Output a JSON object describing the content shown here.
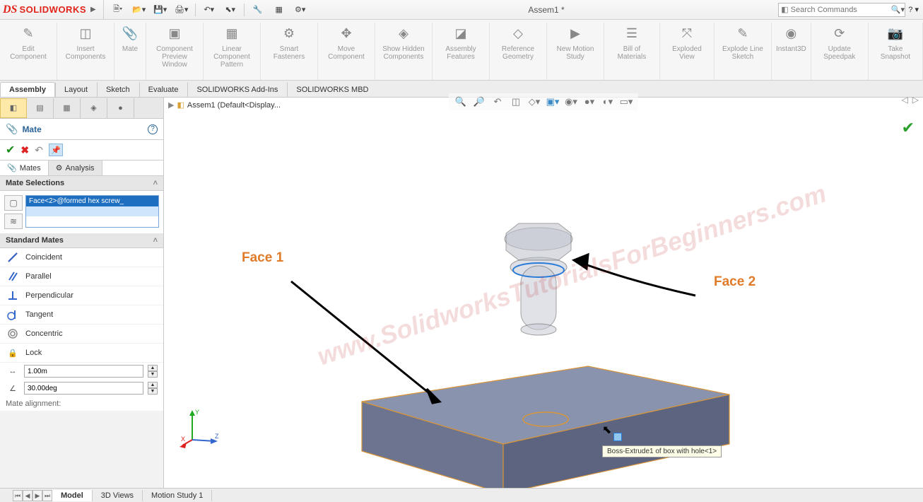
{
  "app": {
    "name": "SOLIDWORKS",
    "doc_title": "Assem1 *"
  },
  "search": {
    "placeholder": "Search Commands"
  },
  "ribbon": [
    {
      "label": "Edit Component"
    },
    {
      "label": "Insert Components"
    },
    {
      "label": "Mate"
    },
    {
      "label": "Component Preview Window"
    },
    {
      "label": "Linear Component Pattern"
    },
    {
      "label": "Smart Fasteners"
    },
    {
      "label": "Move Component"
    },
    {
      "label": "Show Hidden Components"
    },
    {
      "label": "Assembly Features"
    },
    {
      "label": "Reference Geometry"
    },
    {
      "label": "New Motion Study"
    },
    {
      "label": "Bill of Materials"
    },
    {
      "label": "Exploded View"
    },
    {
      "label": "Explode Line Sketch"
    },
    {
      "label": "Instant3D"
    },
    {
      "label": "Update Speedpak"
    },
    {
      "label": "Take Snapshot"
    }
  ],
  "cmd_tabs": [
    "Assembly",
    "Layout",
    "Sketch",
    "Evaluate",
    "SOLIDWORKS Add-Ins",
    "SOLIDWORKS MBD"
  ],
  "breadcrumb": "Assem1  (Default<Display...",
  "mate": {
    "title": "Mate",
    "sub_tabs": {
      "mates": "Mates",
      "analysis": "Analysis"
    },
    "sections": {
      "selections": "Mate Selections",
      "standard": "Standard Mates"
    },
    "selected_face": "Face<2>@formed hex screw_",
    "types": [
      "Coincident",
      "Parallel",
      "Perpendicular",
      "Tangent",
      "Concentric",
      "Lock"
    ],
    "distance": "1.00m",
    "angle": "30.00deg",
    "alignment": "Mate alignment:"
  },
  "bottom_tabs": [
    "Model",
    "3D Views",
    "Motion Study 1"
  ],
  "annotations": {
    "face1": "Face 1",
    "face2": "Face 2"
  },
  "tooltip": "Boss-Extrude1 of box with hole<1>",
  "watermark": "www.SolidworksTutorialsForBeginners.com"
}
